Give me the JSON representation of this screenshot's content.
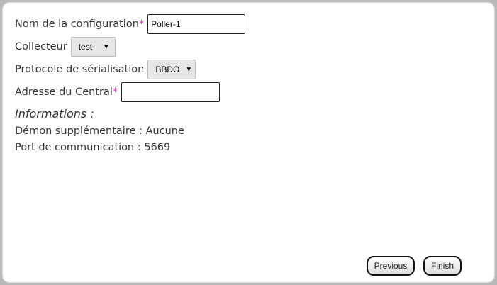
{
  "form": {
    "config_name": {
      "label": "Nom de la configuration",
      "required_mark": "*",
      "value": "Poller-1"
    },
    "collector": {
      "label": "Collecteur",
      "selected": "test"
    },
    "protocol": {
      "label": "Protocole de sérialisation",
      "selected": "BBDO"
    },
    "central_address": {
      "label": "Adresse du Central",
      "required_mark": "*",
      "value": ""
    }
  },
  "info": {
    "title": "Informations :",
    "daemon": "Démon supplémentaire : Aucune",
    "port": "Port de communication : 5669"
  },
  "buttons": {
    "previous": "Previous",
    "finish": "Finish"
  },
  "icons": {
    "dropdown": "▼"
  }
}
